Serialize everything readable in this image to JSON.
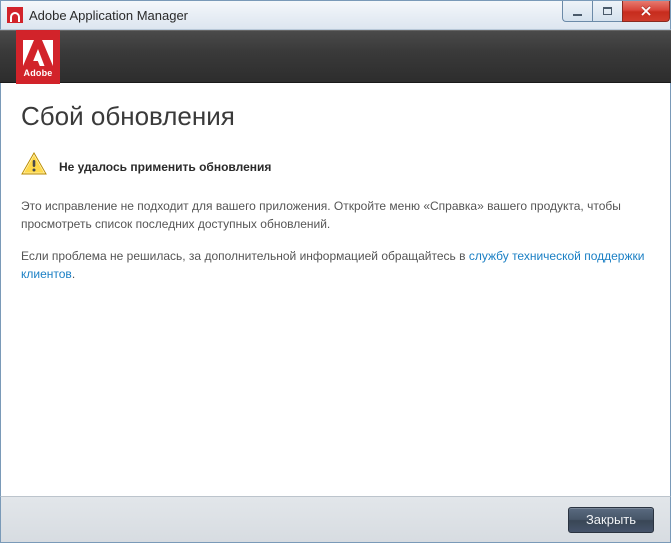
{
  "window": {
    "title": "Adobe Application Manager"
  },
  "brand": {
    "name": "Adobe"
  },
  "main": {
    "title": "Сбой обновления",
    "alert_heading": "Не удалось применить обновления",
    "paragraph1": "Это исправление не подходит для вашего приложения. Откройте меню «Справка» вашего продукта, чтобы просмотреть список последних доступных обновлений.",
    "paragraph2_prefix": "Если проблема не решилась, за дополнительной информацией обращайтесь в ",
    "support_link_text": "службу технической поддержки клиентов",
    "paragraph2_suffix": "."
  },
  "footer": {
    "close_label": "Закрыть"
  }
}
